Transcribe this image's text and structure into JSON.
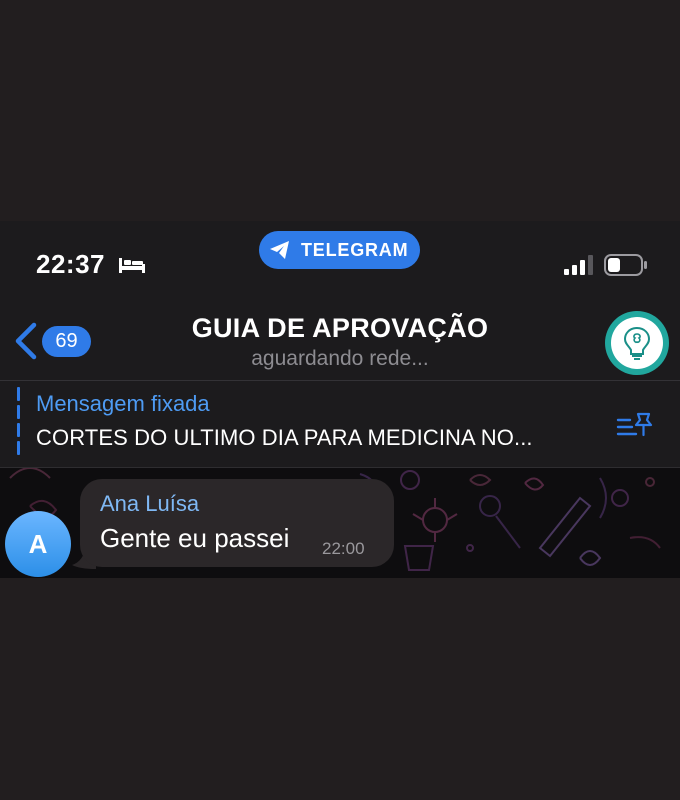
{
  "status_bar": {
    "time": "22:37",
    "app_pill": "TELEGRAM"
  },
  "header": {
    "unread_count": "69",
    "title": "GUIA DE APROVAÇÃO",
    "status": "aguardando rede..."
  },
  "pinned": {
    "label": "Mensagem fixada",
    "text": "CORTES DO ULTIMO DIA PARA MEDICINA NO..."
  },
  "messages": [
    {
      "avatar_letter": "A",
      "sender": "Ana Luísa",
      "text": "Gente eu passei",
      "time": "22:00"
    }
  ],
  "colors": {
    "accent": "#2f7be8",
    "header_bg": "#1c1b1d",
    "bubble_bg": "#2b2729",
    "page_bg": "#221e1f"
  }
}
